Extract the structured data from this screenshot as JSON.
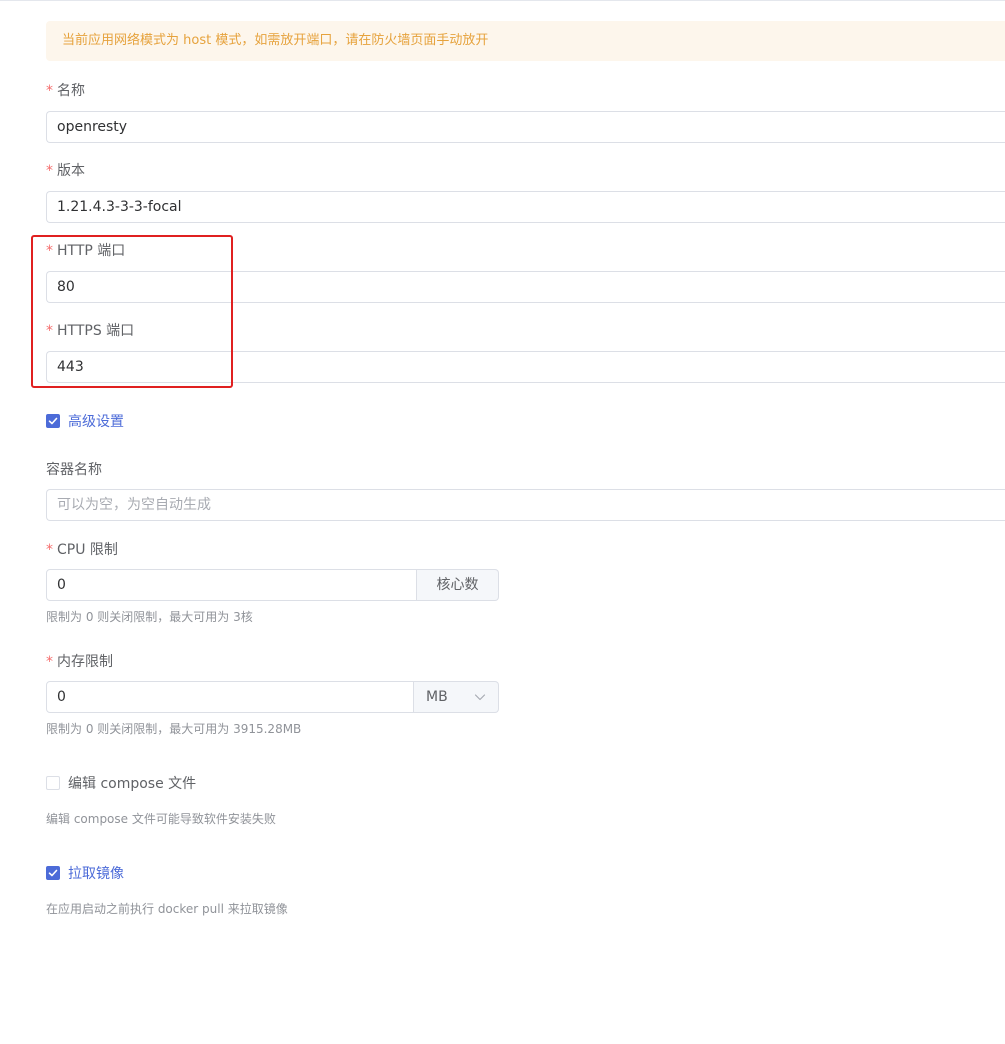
{
  "alert": {
    "text": "当前应用网络模式为 host 模式，如需放开端口，请在防火墙页面手动放开"
  },
  "form": {
    "required_mark": "*",
    "name": {
      "label": "名称",
      "value": "openresty"
    },
    "version": {
      "label": "版本",
      "value": "1.21.4.3-3-3-focal"
    },
    "http_port": {
      "label": "HTTP 端口",
      "value": "80"
    },
    "https_port": {
      "label": "HTTPS 端口",
      "value": "443"
    },
    "advanced": {
      "label": "高级设置",
      "checked": true
    },
    "container_name": {
      "label": "容器名称",
      "value": "",
      "placeholder": "可以为空，为空自动生成"
    },
    "cpu_limit": {
      "label": "CPU 限制",
      "value": "0",
      "unit": "核心数",
      "hint": "限制为 0 则关闭限制，最大可用为 3核"
    },
    "memory_limit": {
      "label": "内存限制",
      "value": "0",
      "unit": "MB",
      "hint": "限制为 0 则关闭限制，最大可用为 3915.28MB"
    },
    "edit_compose": {
      "label": "编辑 compose 文件",
      "checked": false,
      "hint": "编辑 compose 文件可能导致软件安装失败"
    },
    "pull_image": {
      "label": "拉取镜像",
      "checked": true,
      "hint": "在应用启动之前执行 docker pull 来拉取镜像"
    }
  },
  "colors": {
    "primary": "#4c6bd8",
    "required": "#f56c6c",
    "warning_text": "#e6a23c",
    "warning_bg": "#fdf6ec",
    "highlight": "#e02020"
  },
  "icons": {
    "check": "check-icon",
    "select_arrow": "chevron-down-icon"
  }
}
